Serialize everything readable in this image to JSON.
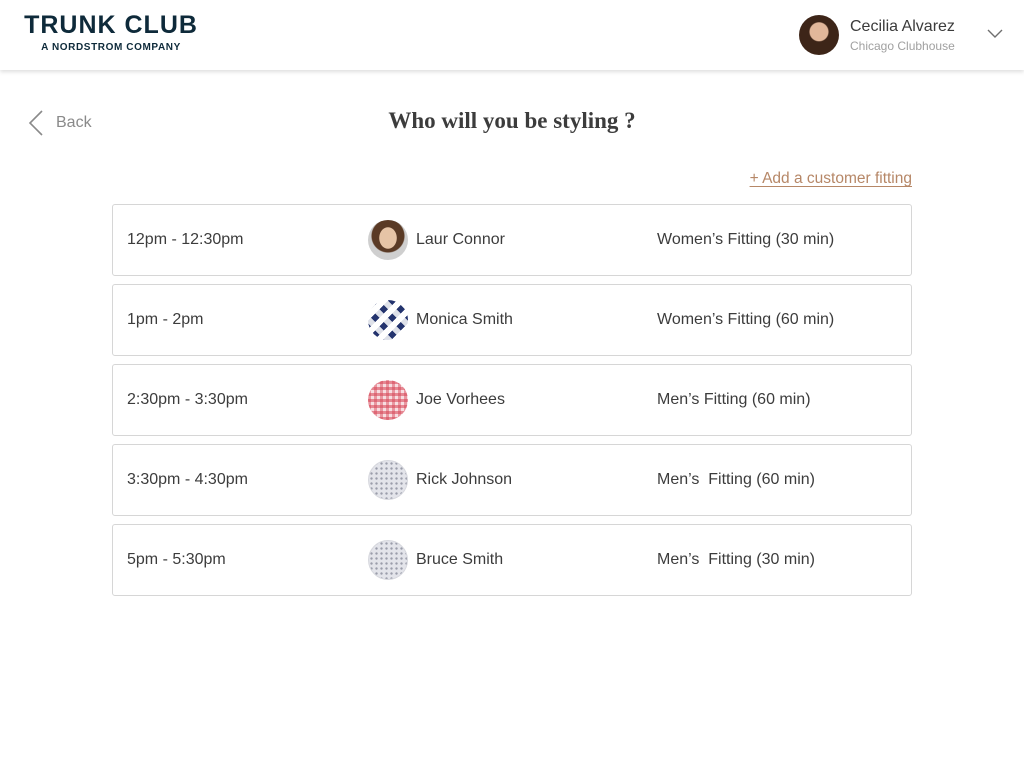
{
  "header": {
    "logo_main": "TRUNK CLUB",
    "logo_sub": "A NORDSTROM COMPANY",
    "user_name": "Cecilia Alvarez",
    "user_location": "Chicago Clubhouse"
  },
  "nav": {
    "back_label": "Back"
  },
  "page": {
    "title": "Who will you be styling ?",
    "add_link": "+ Add a customer fitting"
  },
  "appointments": [
    {
      "time": "12pm - 12:30pm",
      "name": "Laur Connor",
      "fitting": "Women’s Fitting (30 min)",
      "avatar": "photo"
    },
    {
      "time": "1pm - 2pm",
      "name": "Monica Smith",
      "fitting": "Women’s Fitting (60 min)",
      "avatar": "navy-plaid"
    },
    {
      "time": "2:30pm - 3:30pm",
      "name": "Joe Vorhees",
      "fitting": "Men’s Fitting (60 min)",
      "avatar": "red-gingham"
    },
    {
      "time": "3:30pm - 4:30pm",
      "name": "Rick Johnson",
      "fitting": "Men’s  Fitting (60 min)",
      "avatar": "grey-dots"
    },
    {
      "time": "5pm - 5:30pm",
      "name": "Bruce Smith",
      "fitting": "Men’s  Fitting (30 min)",
      "avatar": "grey-dots"
    }
  ],
  "colors": {
    "brand": "#0e2a3a",
    "link": "#b68767",
    "border": "#d6d6d6",
    "text": "#3c3c3c"
  }
}
